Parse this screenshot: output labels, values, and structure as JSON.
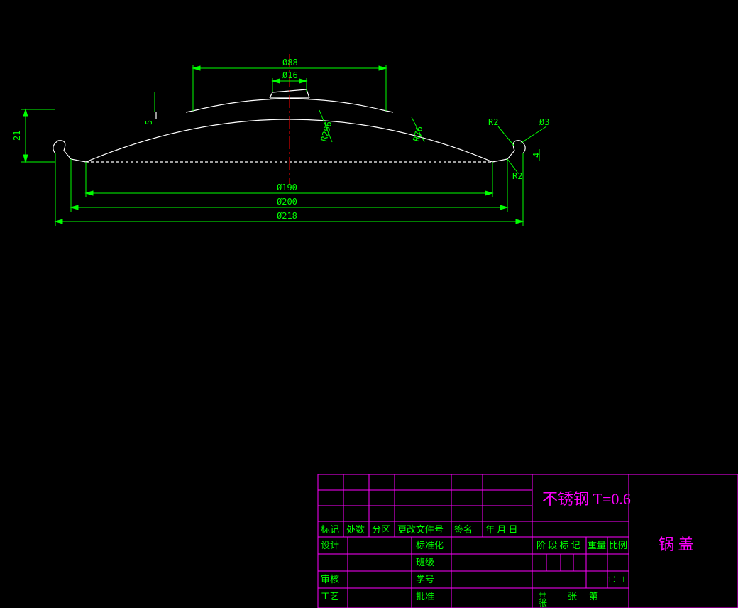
{
  "dimensions": {
    "d88": "Ø88",
    "d16": "Ø16",
    "r296": "R296",
    "r76": "R76",
    "r2a": "R2",
    "r2b": "R2",
    "d3": "Ø3",
    "h21": "21",
    "h5": "5",
    "h4": "4",
    "d190": "Ø190",
    "d200": "Ø200",
    "d218": "Ø218"
  },
  "titleblock": {
    "material": "不锈钢   T=0.6",
    "part_name": "锅  盖",
    "row_revision": {
      "mark": "标记",
      "qty": "处数",
      "zone": "分区",
      "change": "更改文件号",
      "sign": "签名",
      "date": "年 月 日"
    },
    "design": "设计",
    "standard": "标准化",
    "class": "班级",
    "review": "审核",
    "student_id": "学号",
    "process": "工艺",
    "approve": "批准",
    "stage": "阶 段 标 记",
    "weight": "重量",
    "scale": "比例",
    "scale_v": "1：1",
    "sheets": "共",
    "sheet": "张",
    "sheet2": "第",
    "sheet3": "张"
  }
}
